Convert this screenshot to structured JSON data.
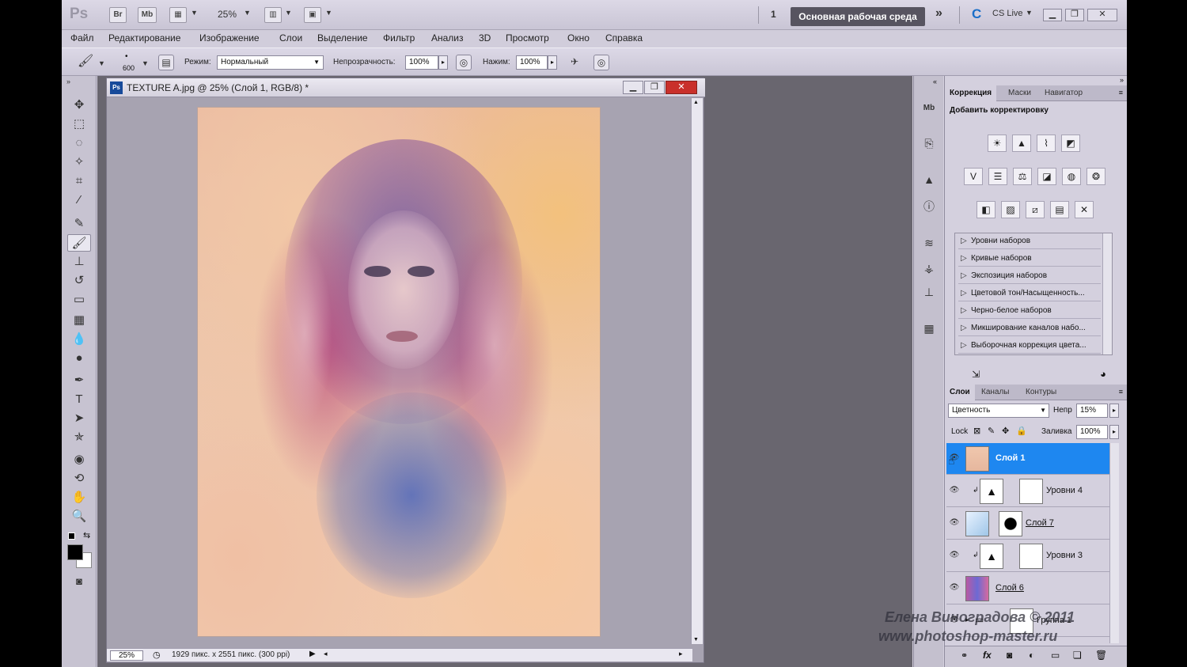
{
  "app": {
    "logo": "Ps",
    "zoom": "25%"
  },
  "topbar": {
    "br_label": "Br",
    "mb_label": "Mb",
    "workspace_number": "1",
    "workspace_label": "Основная рабочая среда",
    "cs_live": "CS Live"
  },
  "menu": [
    "Файл",
    "Редактирование",
    "Изображение",
    "Слои",
    "Выделение",
    "Фильтр",
    "Анализ",
    "3D",
    "Просмотр",
    "Окно",
    "Справка"
  ],
  "options": {
    "brush_size": "600",
    "mode_label": "Режим:",
    "mode_value": "Нормальный",
    "opacity_label": "Непрозрачность:",
    "opacity_value": "100%",
    "pressure_label": "Нажим:",
    "pressure_value": "100%"
  },
  "document": {
    "title": "TEXTURE A.jpg @ 25% (Слой 1, RGB/8) *",
    "zoom": "25%",
    "info": "1929 пикс. x 2551 пикс. (300 ppi)"
  },
  "adjustments": {
    "tabs": [
      "Коррекция",
      "Маски",
      "Навигатор"
    ],
    "heading": "Добавить корректировку",
    "presets": [
      "Уровни наборов",
      "Кривые наборов",
      "Экспозиция наборов",
      "Цветовой тон/Насыщенность...",
      "Черно-белое наборов",
      "Микширование каналов набо...",
      "Выборочная коррекция цвета..."
    ]
  },
  "layers": {
    "tabs": [
      "Слои",
      "Каналы",
      "Контуры"
    ],
    "blend_mode": "Цветность",
    "opacity_label": "Непр",
    "opacity_value": "15%",
    "lock_label": "Lock",
    "fill_label": "Заливка",
    "fill_value": "100%",
    "items": [
      {
        "name": "Слой 1"
      },
      {
        "name": "Уровни 4"
      },
      {
        "name": "Слой 7"
      },
      {
        "name": "Уровни 3"
      },
      {
        "name": "Слой 6"
      },
      {
        "name": "Группа 1"
      }
    ]
  },
  "watermark": {
    "line1": "Елена Виноградова © 2011",
    "line2": "www.photoshop-master.ru"
  },
  "colors": {
    "accent": "#1e87f0",
    "workspace_bg": "#575460",
    "close_red": "#c9302b"
  }
}
